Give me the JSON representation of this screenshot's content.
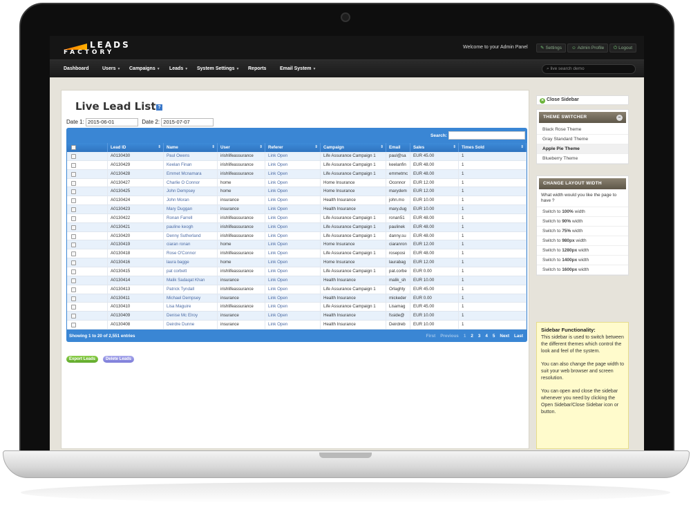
{
  "header": {
    "logo_line1": "LEADS",
    "logo_line2": "FACTORY",
    "welcome": "Welcome to your Admin Panel",
    "settings": "Settings",
    "admin_profile": "Admin Profile",
    "logout": "Logout"
  },
  "nav": {
    "dashboard": "Dashboard",
    "users": "Users",
    "campaigns": "Campaigns",
    "leads": "Leads",
    "system_settings": "System Settings",
    "reports": "Reports",
    "email_system": "Email System",
    "live_search_placeholder": "live search demo"
  },
  "page": {
    "title": "Live Lead List",
    "help": "?",
    "date1_label": "Date 1:",
    "date1_value": "2015-06-01",
    "date2_label": "Date 2:",
    "date2_value": "2015-07-07",
    "search_label": "Search:"
  },
  "table": {
    "columns": [
      "Lead ID",
      "Name",
      "User",
      "Referer",
      "Campaign",
      "Email",
      "Sales",
      "Times Sold"
    ],
    "rows": [
      [
        "A0130430",
        "Paul Owens",
        "irishlifeassurance",
        "Link Open",
        "Life Assurance Campaign 1",
        "paul@sa",
        "EUR 45.00",
        "1"
      ],
      [
        "A0130429",
        "Keelan Finan",
        "irishlifeassurance",
        "Link Open",
        "Life Assurance Campaign 1",
        "keelanfin",
        "EUR 48.00",
        "1"
      ],
      [
        "A0130428",
        "Emmet Mcnamara",
        "irishlifeassurance",
        "Link Open",
        "Life Assurance Campaign 1",
        "emmetmc",
        "EUR 48.00",
        "1"
      ],
      [
        "A0130427",
        "Charlie O Connor",
        "home",
        "Link Open",
        "Home Insurance",
        "Oconnor",
        "EUR 12.00",
        "1"
      ],
      [
        "A0130425",
        "John Dempsey",
        "home",
        "Link Open",
        "Home Insurance",
        "marydem",
        "EUR 12.00",
        "1"
      ],
      [
        "A0130424",
        "John Moran",
        "insurance",
        "Link Open",
        "Health Insurance",
        "john.mo",
        "EUR 10.00",
        "1"
      ],
      [
        "A0130423",
        "Mary Duggan",
        "insurance",
        "Link Open",
        "Health Insurance",
        "mary.dug",
        "EUR 10.00",
        "1"
      ],
      [
        "A0130422",
        "Ronan Farrell",
        "irishlifeassurance",
        "Link Open",
        "Life Assurance Campaign 1",
        "ronan51",
        "EUR 48.00",
        "1"
      ],
      [
        "A0130421",
        "pauline keogh",
        "irishlifeassurance",
        "Link Open",
        "Life Assurance Campaign 1",
        "paulinek",
        "EUR 48.00",
        "1"
      ],
      [
        "A0130420",
        "Denny Sutherland",
        "irishlifeassurance",
        "Link Open",
        "Life Assurance Campaign 1",
        "danny.su",
        "EUR 48.00",
        "1"
      ],
      [
        "A0130419",
        "ciaran ronan",
        "home",
        "Link Open",
        "Home Insurance",
        "ciaranron",
        "EUR 12.00",
        "1"
      ],
      [
        "A0130418",
        "Rose O'Connor",
        "irishlifeassurance",
        "Link Open",
        "Life Assurance Campaign 1",
        "roseposi",
        "EUR 48.00",
        "1"
      ],
      [
        "A0130416",
        "laura bagge",
        "home",
        "Link Open",
        "Home Insurance",
        "laurabag",
        "EUR 12.00",
        "1"
      ],
      [
        "A0130415",
        "pat corbett",
        "irishlifeassurance",
        "Link Open",
        "Life Assurance Campaign 1",
        "pat.corbe",
        "EUR 0.00",
        "1"
      ],
      [
        "A0130414",
        "Malik Sadaqat Khan",
        "insurance",
        "Link Open",
        "Health Insurance",
        "malik_sh",
        "EUR 10.00",
        "1"
      ],
      [
        "A0130413",
        "Patrick Tyndall",
        "irishlifeassurance",
        "Link Open",
        "Life Assurance Campaign 1",
        "Orlaghty",
        "EUR 45.00",
        "1"
      ],
      [
        "A0130411",
        "Michael Dempsey",
        "insurance",
        "Link Open",
        "Health Insurance",
        "mickeder",
        "EUR 0.00",
        "1"
      ],
      [
        "A0130410",
        "Lisa Maguire",
        "irishlifeassurance",
        "Link Open",
        "Life Assurance Campaign 1",
        "Lisamag",
        "EUR 45.00",
        "1"
      ],
      [
        "A0130409",
        "Denise Mc Elroy",
        "insurance",
        "Link Open",
        "Health Insurance",
        "fsside@",
        "EUR 10.00",
        "1"
      ],
      [
        "A0130408",
        "Deirdre Dunne",
        "insurance",
        "Link Open",
        "Health Insurance",
        "Deirdreb",
        "EUR 10.00",
        "1"
      ]
    ],
    "footer_info": "Showing 1 to 20 of 2,551 entries",
    "pager": [
      "First",
      "Previous",
      "1",
      "2",
      "3",
      "4",
      "5",
      "Next",
      "Last"
    ]
  },
  "actions": {
    "export": "Export Leads",
    "delete": "Delete Leads"
  },
  "sidebar": {
    "close": "Close Sidebar",
    "theme_title": "THEME SWITCHER",
    "themes": [
      "Black Rose Theme",
      "Gray Standard Theme",
      "Apple Pie Theme",
      "Blueberry Theme"
    ],
    "active_theme_index": 2,
    "layout_title": "CHANGE LAYOUT WIDTH",
    "layout_question": "What width would you like the page to have ?",
    "widths": [
      {
        "pre": "Switch to ",
        "val": "100%",
        "post": " width"
      },
      {
        "pre": "Switch to ",
        "val": "90%",
        "post": " width"
      },
      {
        "pre": "Switch to ",
        "val": "75%",
        "post": " width"
      },
      {
        "pre": "Switch to ",
        "val": "980px",
        "post": " width"
      },
      {
        "pre": "Switch to ",
        "val": "1280px",
        "post": " width"
      },
      {
        "pre": "Switch to ",
        "val": "1400px",
        "post": " width"
      },
      {
        "pre": "Switch to ",
        "val": "1600px",
        "post": " width"
      }
    ],
    "info_title": "Sidebar Functionality:",
    "info_p1": "This sidebar is used to switch between the different themes which control the look and feel of the system.",
    "info_p2": "You can also change the page width to suit your web browser and screen resolution.",
    "info_p3": "You can open and close the sidebar whenever you need by clicking the Open Sidebar/Close Sidebar icon or button."
  }
}
